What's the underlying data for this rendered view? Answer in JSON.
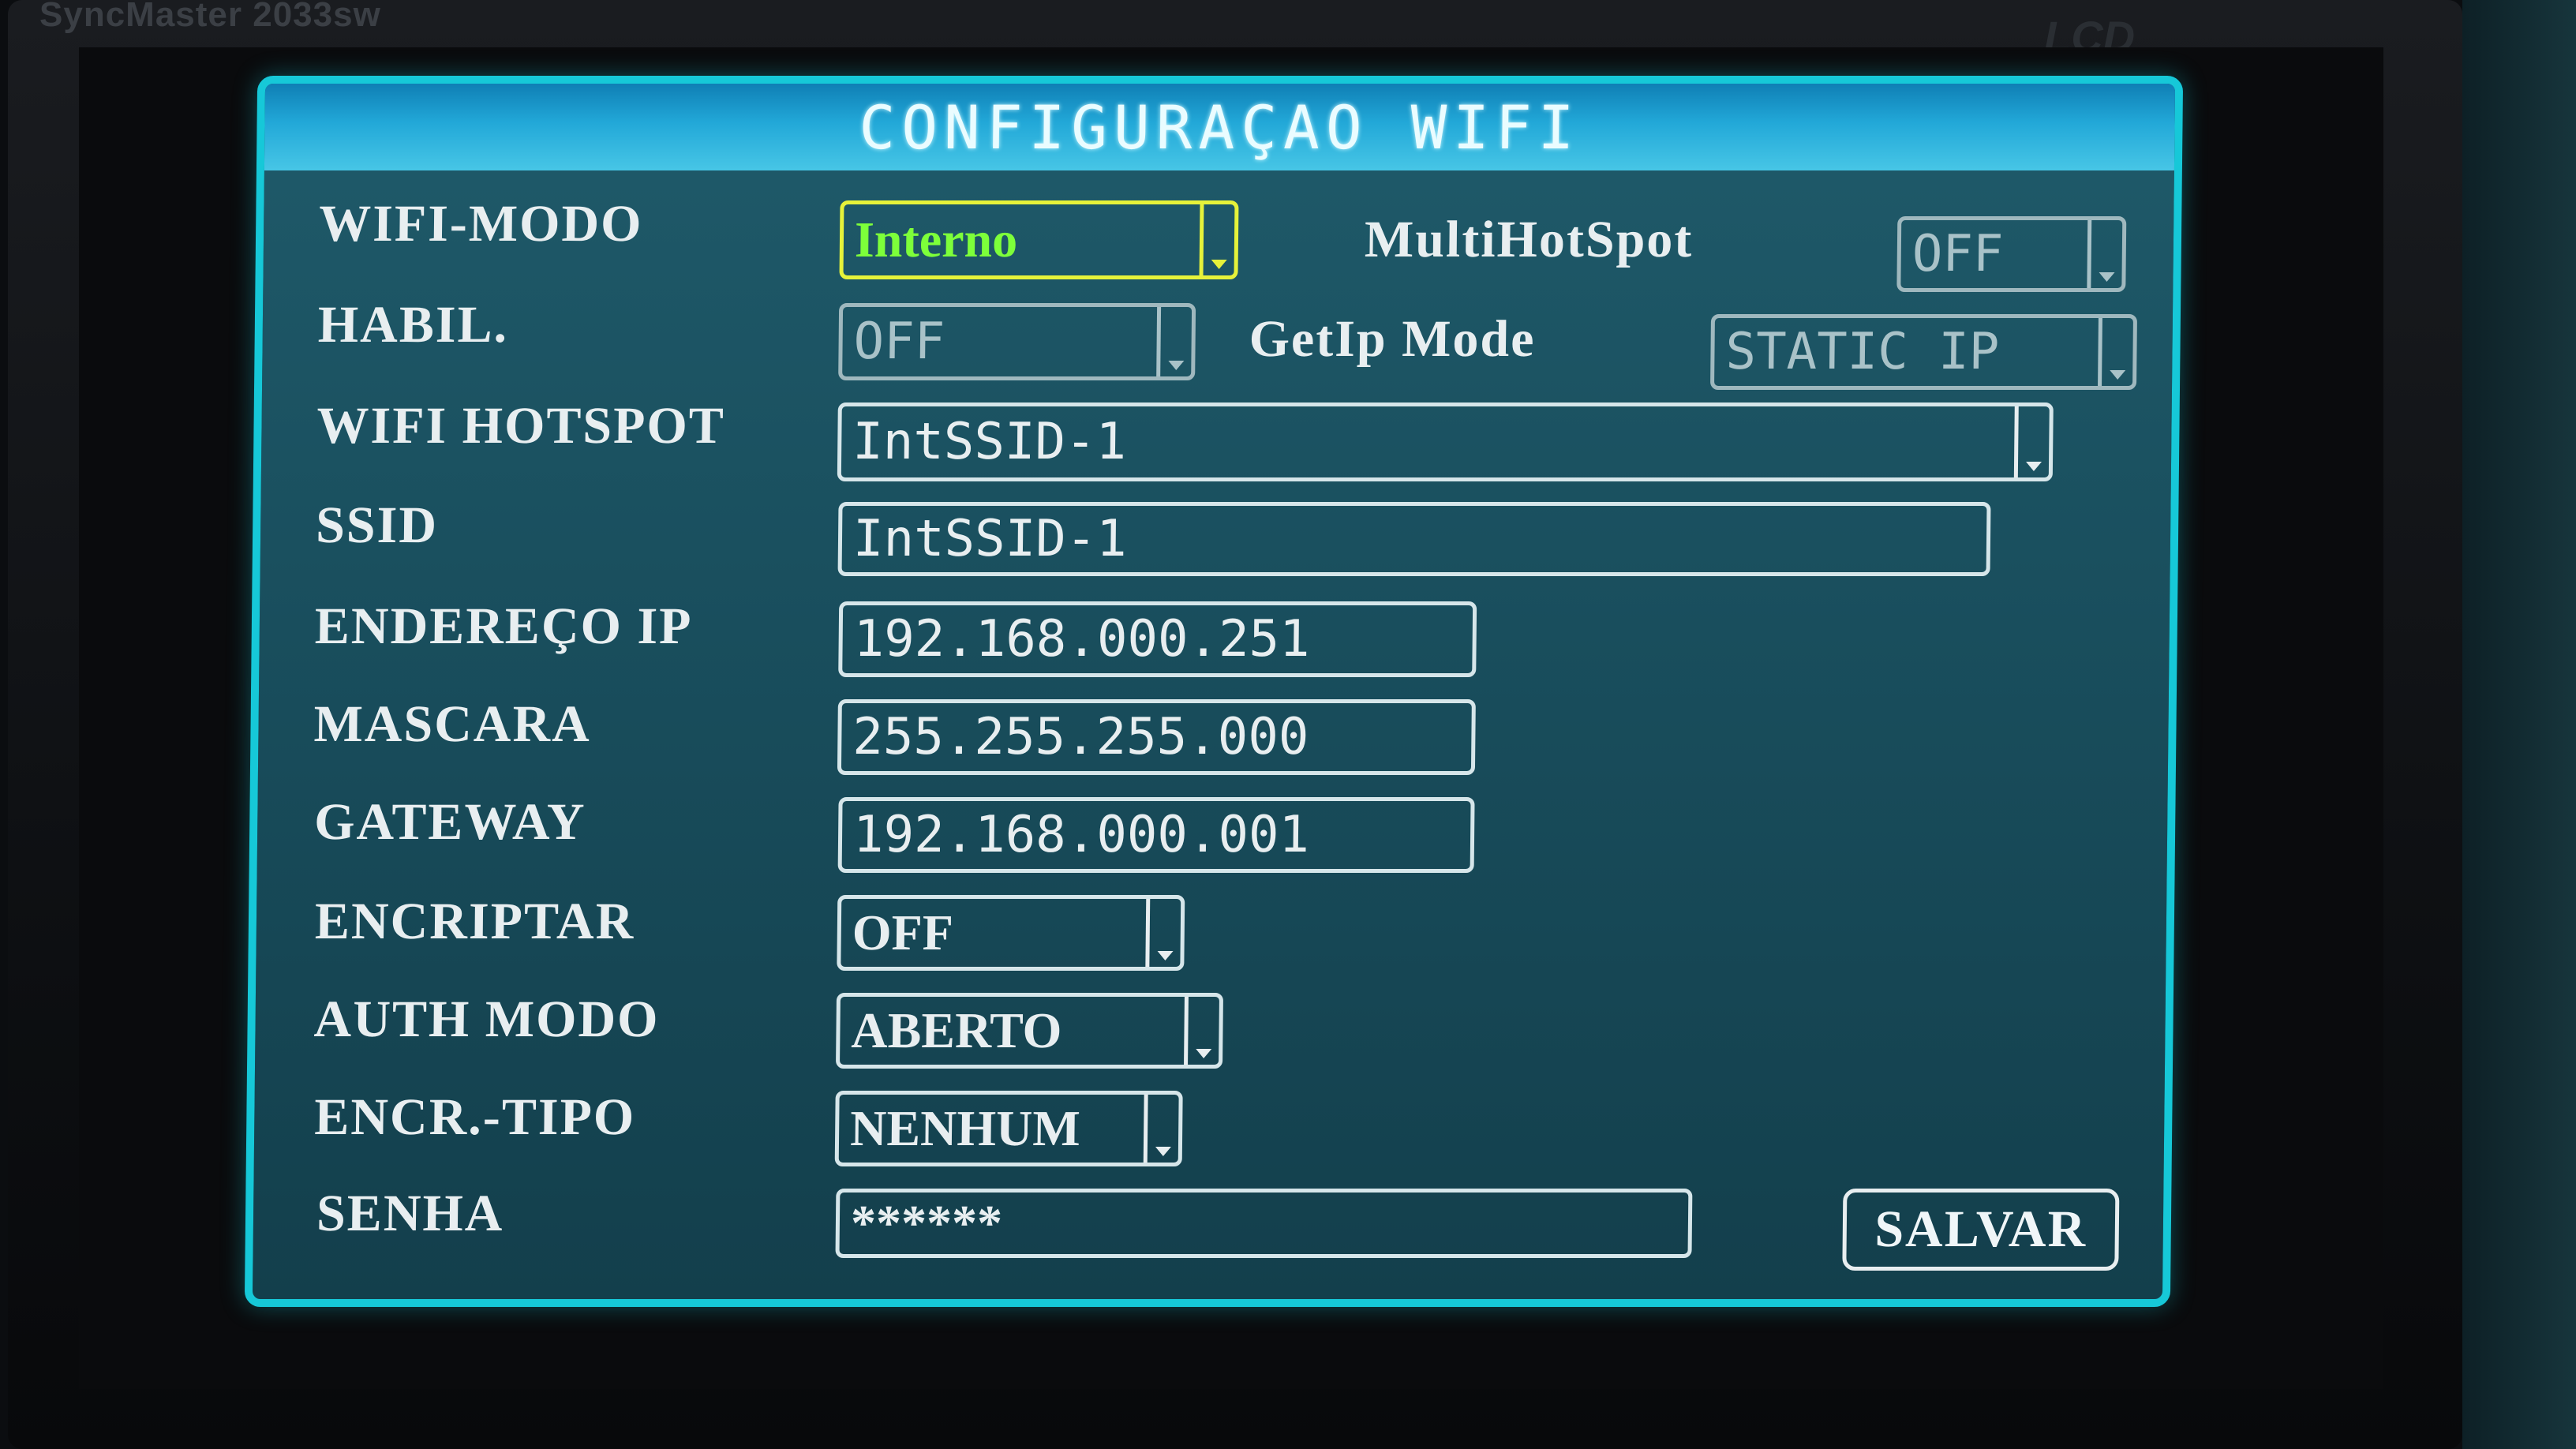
{
  "monitor": {
    "brand": "SyncMaster 2033sw",
    "badge": "LCD"
  },
  "osd": {
    "title": "CONFIGURAÇAO WIFI",
    "labels": {
      "wifi_mode": "WIFI-MODO",
      "multihotspot": "MultiHotSpot",
      "enable": "HABIL.",
      "getip_mode": "GetIp Mode",
      "wifi_hotspot": "WIFI HOTSPOT",
      "ssid": "SSID",
      "ip_address": "ENDEREÇO IP",
      "mask": "MASCARA",
      "gateway": "GATEWAY",
      "encrypt": "ENCRIPTAR",
      "auth_mode": "AUTH MODO",
      "encr_type": "ENCR.-TIPO",
      "password": "SENHA"
    },
    "values": {
      "wifi_mode": "Interno",
      "multihotspot": "OFF",
      "enable": "OFF",
      "getip_mode": "STATIC IP",
      "wifi_hotspot": "IntSSID-1",
      "ssid": "IntSSID-1",
      "ip_address": "192.168.000.251",
      "mask": "255.255.255.000",
      "gateway": "192.168.000.001",
      "encrypt": "OFF",
      "auth_mode": "ABERTO",
      "encr_type": "NENHUM",
      "password": "******"
    },
    "save_label": "SALVAR",
    "colors": {
      "frame": "#16c8d8",
      "focus_border": "#e6f23a",
      "focus_text": "#7dff3a"
    }
  }
}
